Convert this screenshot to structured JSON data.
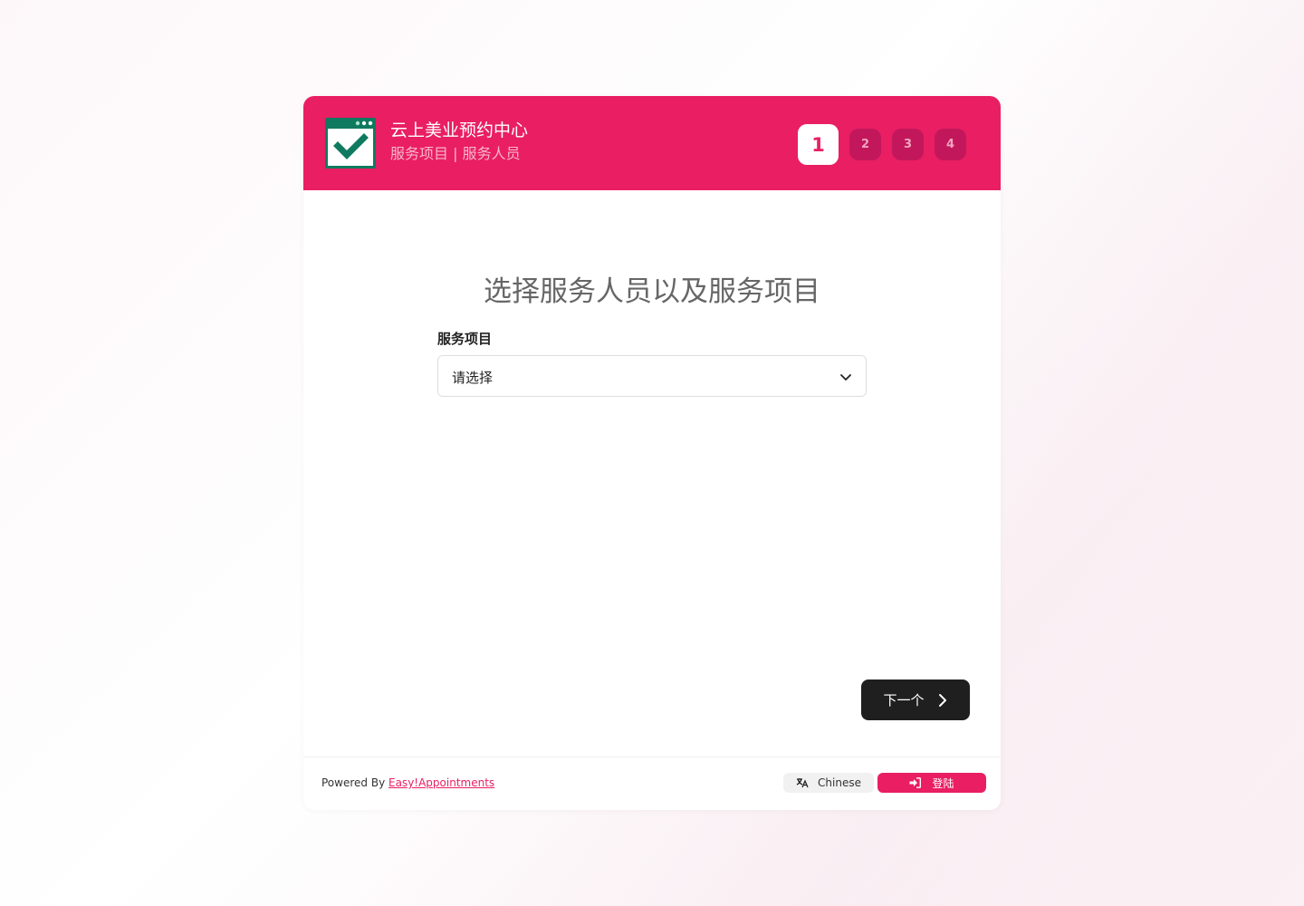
{
  "header": {
    "company_name": "云上美业预约中心",
    "subtitle": "服务项目 | 服务人员",
    "steps": [
      "1",
      "2",
      "3",
      "4"
    ],
    "active_step": 1
  },
  "main": {
    "title": "选择服务人员以及服务项目",
    "service_label": "服务项目",
    "service_select_value": "请选择",
    "next_label": "下一个"
  },
  "footer": {
    "powered_prefix": "Powered By",
    "powered_link": "Easy!Appointments",
    "language_label": "Chinese",
    "login_label": "登陆"
  },
  "colors": {
    "brand": "#e91e63",
    "step_inactive": "#c2185b",
    "dark_button": "#1f1f1f"
  },
  "icons": {
    "logo": "calendar-check-icon",
    "select": "chevron-down-icon",
    "next": "chevron-right-icon",
    "language": "translate-icon",
    "login": "sign-in-icon"
  }
}
